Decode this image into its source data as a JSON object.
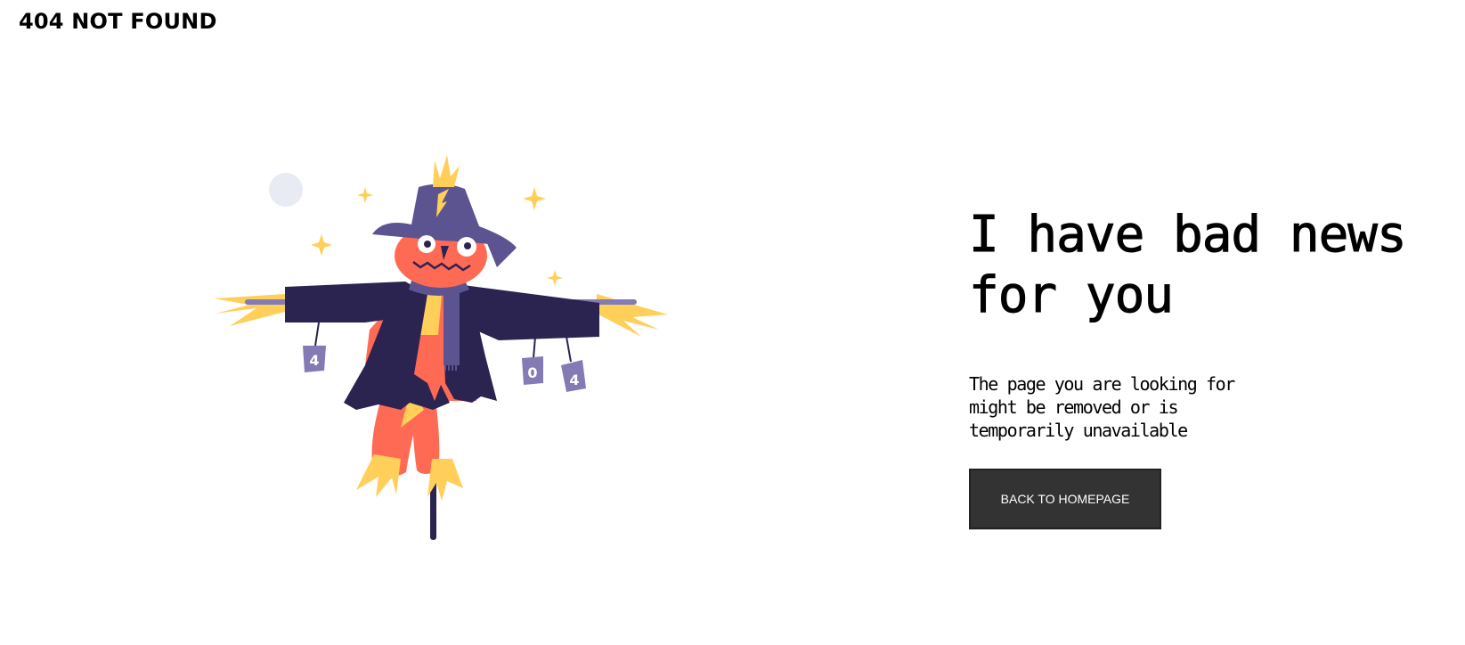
{
  "header": {
    "title": "404 NOT FOUND"
  },
  "illustration": {
    "subject": "scarecrow",
    "can_labels": [
      "4",
      "0",
      "4"
    ]
  },
  "main": {
    "headline": "I have bad news for you",
    "message": "The page you are looking for might be removed or is temporarily unavailable",
    "button_label": "BACK TO HOMEPAGE"
  },
  "colors": {
    "hat": "#5c5490",
    "coat": "#2b2350",
    "face": "#ff6a55",
    "straw": "#ffcf5a",
    "cans": "#847bb5",
    "moon": "#e8eaf4",
    "button": "#333333"
  }
}
